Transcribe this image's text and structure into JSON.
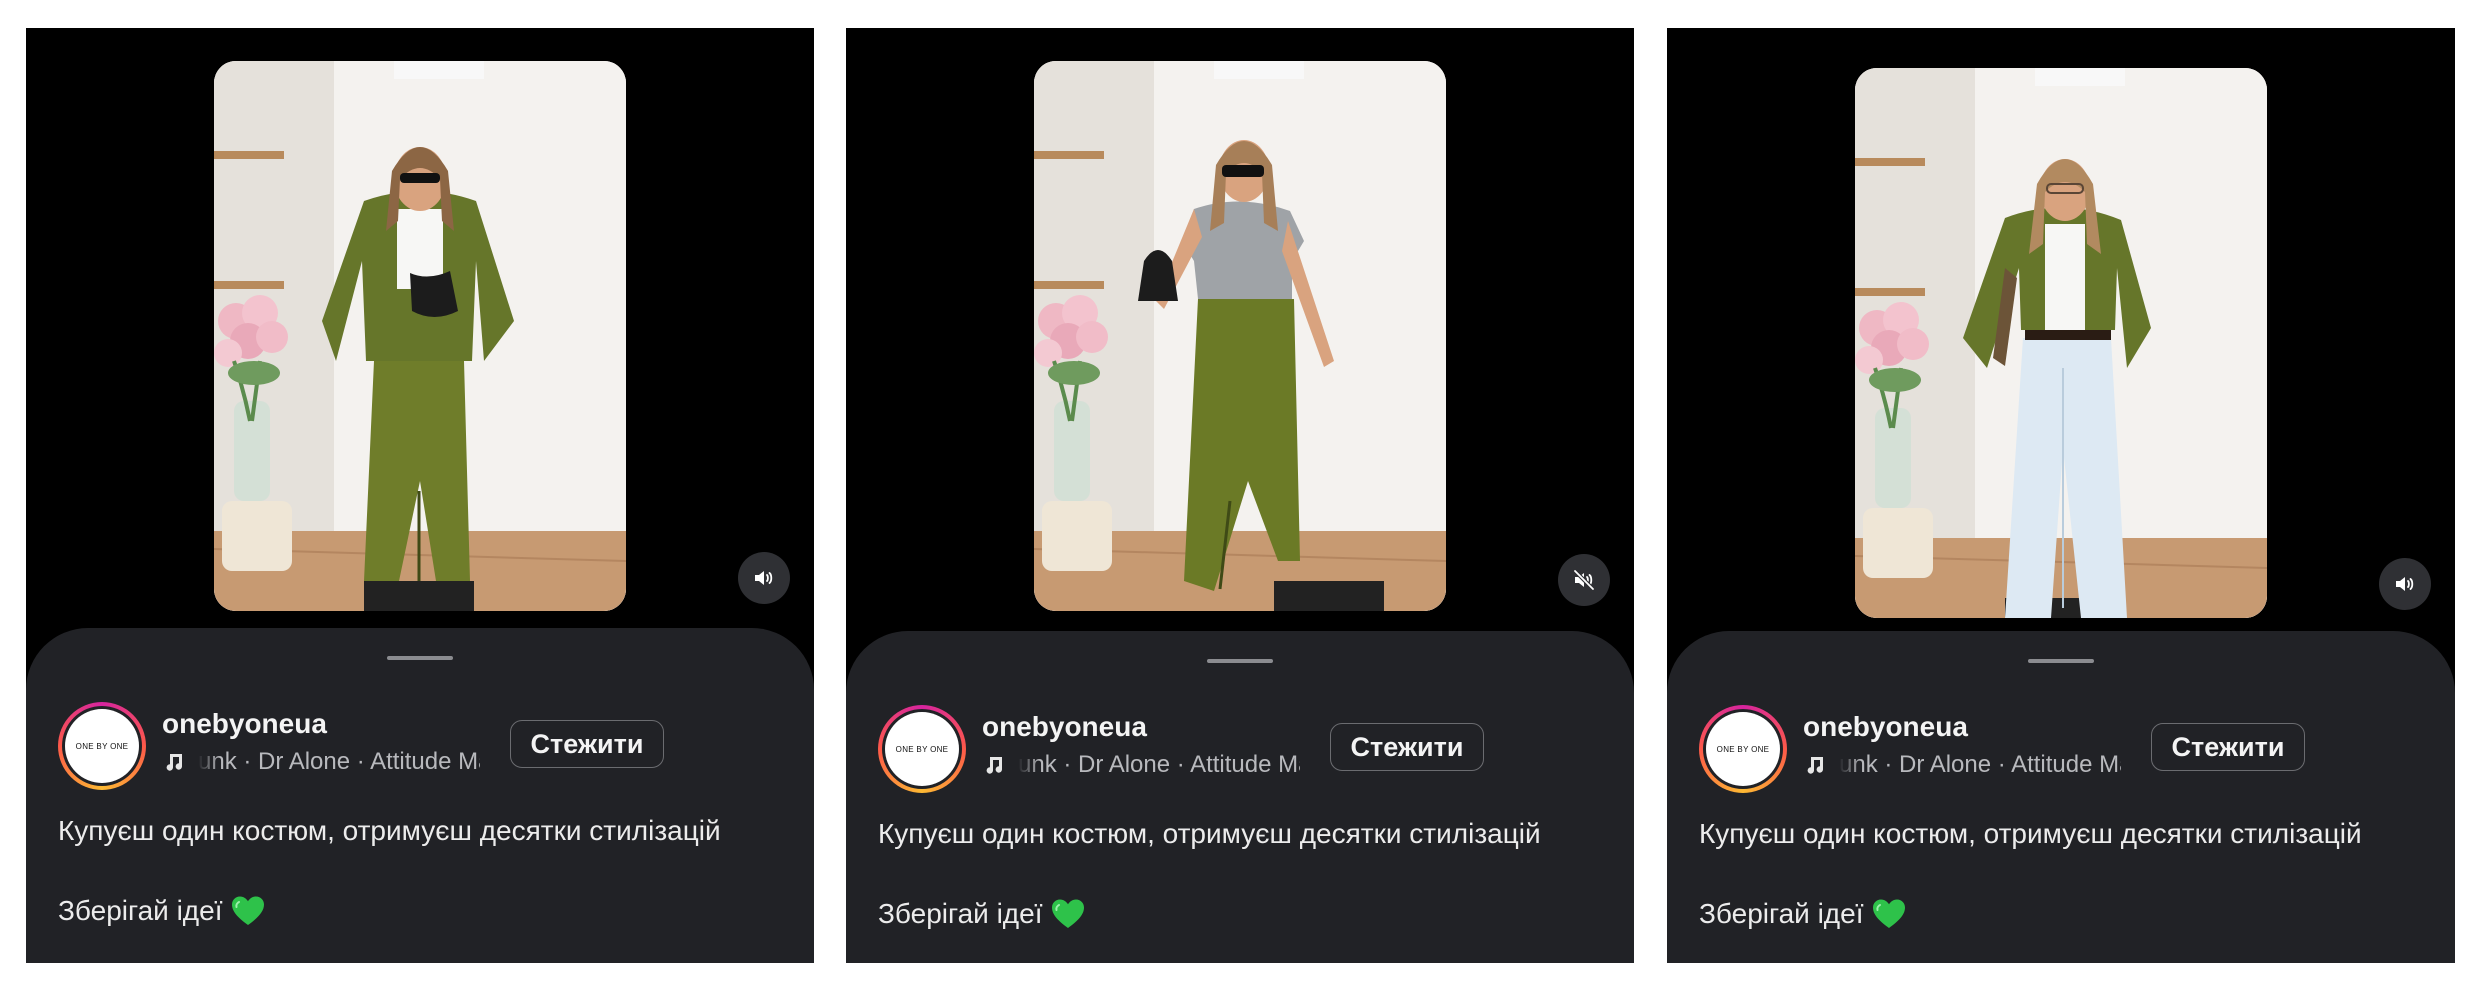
{
  "posts": [
    {
      "username": "onebyoneua",
      "audio": "unk · Dr Alone · Attitude Ma",
      "follow_label": "Стежити",
      "caption_line1": "Купуєш один костюм, отримуєш десятки стилізацій",
      "caption_line2": "Зберігай ідеї",
      "avatar_text": "ONE BY ONE",
      "sound_state": "sound-on",
      "outfit": "green leather jacket, white top, green leather midi skirt, sunglasses, black bag"
    },
    {
      "username": "onebyoneua",
      "audio": "unk · Dr Alone · Attitude Ma",
      "follow_label": "Стежити",
      "caption_line1": "Купуєш один костюм, отримуєш десятки стилізацій",
      "caption_line2": "Зберігай ідеї",
      "avatar_text": "ONE BY ONE",
      "sound_state": "muted",
      "outfit": "grey knit top, green leather midi skirt, sunglasses, black bag"
    },
    {
      "username": "onebyoneua",
      "audio": "unk · Dr Alone · Attitude Ma",
      "follow_label": "Стежити",
      "caption_line1": "Купуєш один костюм, отримуєш десятки стилізацій",
      "caption_line2": "Зберігай ідеї",
      "avatar_text": "ONE BY ONE",
      "sound_state": "sound-on",
      "outfit": "green leather jacket, white top, light blue wide jeans, glasses"
    }
  ],
  "icons": {
    "sound": "speaker-icon",
    "muted": "speaker-muted-icon",
    "music": "music-note-icon",
    "heart": "green-heart-emoji"
  },
  "colors": {
    "background": "#000000",
    "sheet": "#212226",
    "text": "#f4f4f4",
    "muted_text": "#b8b9bd",
    "heart": "#2ec24a"
  }
}
